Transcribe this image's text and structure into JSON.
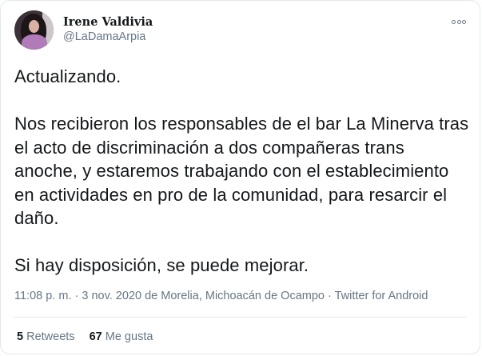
{
  "author": {
    "display_name": "Irene Valdivia",
    "handle": "@LaDamaArpia"
  },
  "tweet": {
    "paragraphs": [
      "Actualizando.",
      "Nos recibieron los responsables de el bar La Minerva tras el acto de discriminación a dos compañeras trans anoche, y estaremos trabajando con el establecimiento en actividades en pro de la comunidad, para resarcir el daño.",
      "Si hay disposición, se puede mejorar."
    ]
  },
  "meta": {
    "time": "11:08 p. m.",
    "sep1": " · ",
    "date": "3 nov. 2020",
    "from_label": " de ",
    "location": "Morelia, Michoacán de Ocampo",
    "sep2": " · ",
    "source": "Twitter for Android"
  },
  "stats": {
    "retweets_count": "5",
    "retweets_label": "Retweets",
    "likes_count": "67",
    "likes_label": "Me gusta"
  },
  "icons": {
    "more": "more-options-icon"
  }
}
